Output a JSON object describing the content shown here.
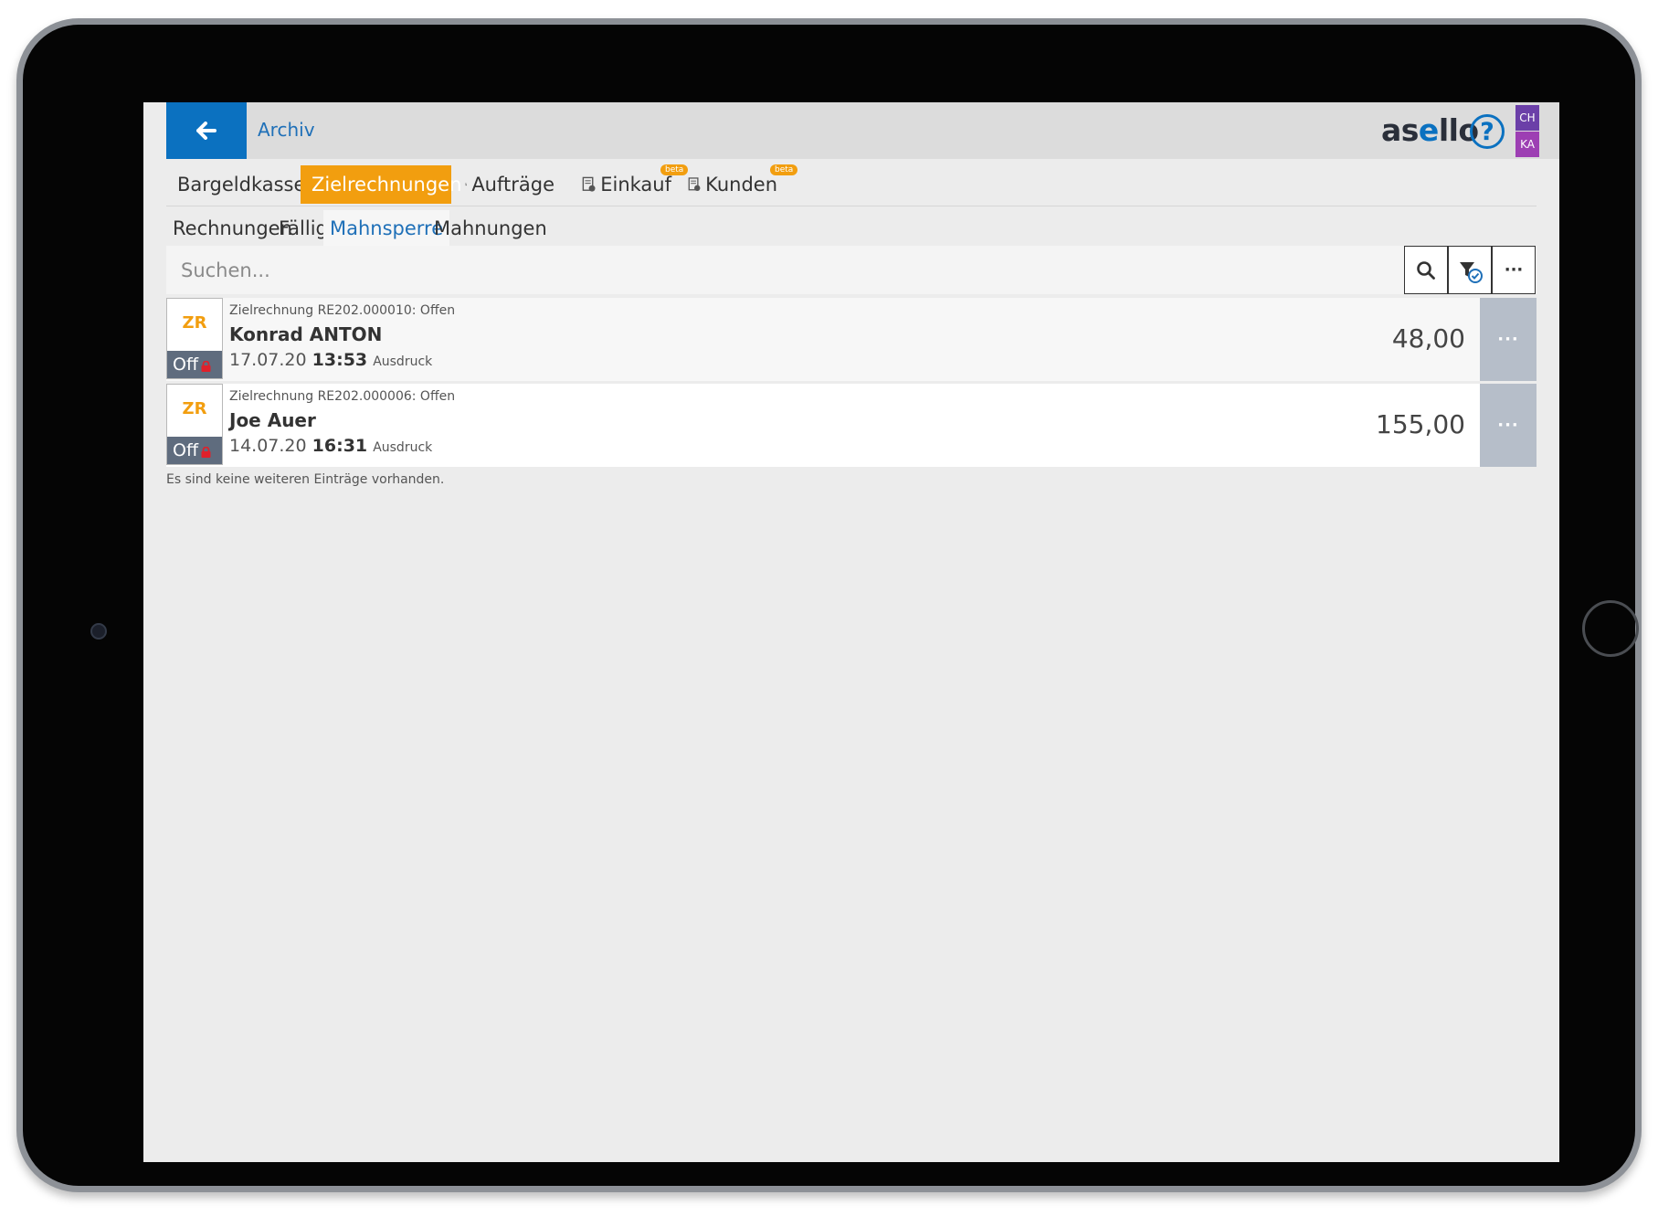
{
  "header": {
    "back_icon": "arrow-left-icon",
    "title": "Archiv",
    "brand_prefix": "as",
    "brand_accent": "e",
    "brand_suffix": "llo",
    "help_label": "?",
    "user_badges": [
      "CH",
      "KA"
    ]
  },
  "tabs": [
    {
      "label": "Bargeldkasse",
      "icon": "invoice-doc-icon",
      "active": false
    },
    {
      "label": "Zielrechnungen",
      "icon": "invoice-doc-icon",
      "active": true
    },
    {
      "label": "Aufträge",
      "icon": "invoice-doc-icon",
      "active": false
    },
    {
      "label": "Einkauf",
      "icon": "invoice-doc-icon",
      "active": false,
      "badge": "beta"
    },
    {
      "label": "Kunden",
      "icon": "invoice-doc-icon",
      "active": false,
      "badge": "beta"
    }
  ],
  "subtabs": [
    {
      "label": "Rechnungen",
      "active": false
    },
    {
      "label": "Fällig",
      "active": false
    },
    {
      "label": "Mahnsperre",
      "active": true
    },
    {
      "label": "Mahnungen",
      "active": false
    }
  ],
  "search": {
    "placeholder": "Suchen...",
    "value": "",
    "search_icon": "search-icon",
    "filter_icon": "filter-check-icon",
    "more_label": "···"
  },
  "rows": [
    {
      "badge_type": "ZR",
      "badge_status": "Off",
      "subtitle": "Zielrechnung RE202.000010: Offen",
      "name": "Konrad ANTON",
      "date": "17.07.20",
      "time": "13:53",
      "tag": "Ausdruck",
      "amount": "48,00",
      "more_label": "···"
    },
    {
      "badge_type": "ZR",
      "badge_status": "Off",
      "subtitle": "Zielrechnung RE202.000006: Offen",
      "name": "Joe Auer",
      "date": "14.07.20",
      "time": "16:31",
      "tag": "Ausdruck",
      "amount": "155,00",
      "more_label": "···"
    }
  ],
  "footer_note": "Es sind keine weiteren Einträge vorhanden.",
  "colors": {
    "primary": "#0b71c0",
    "accent": "#f29e0f",
    "status_badge": "#5f6c7e",
    "lock": "#e0202a",
    "row_more": "#b6bec9"
  }
}
